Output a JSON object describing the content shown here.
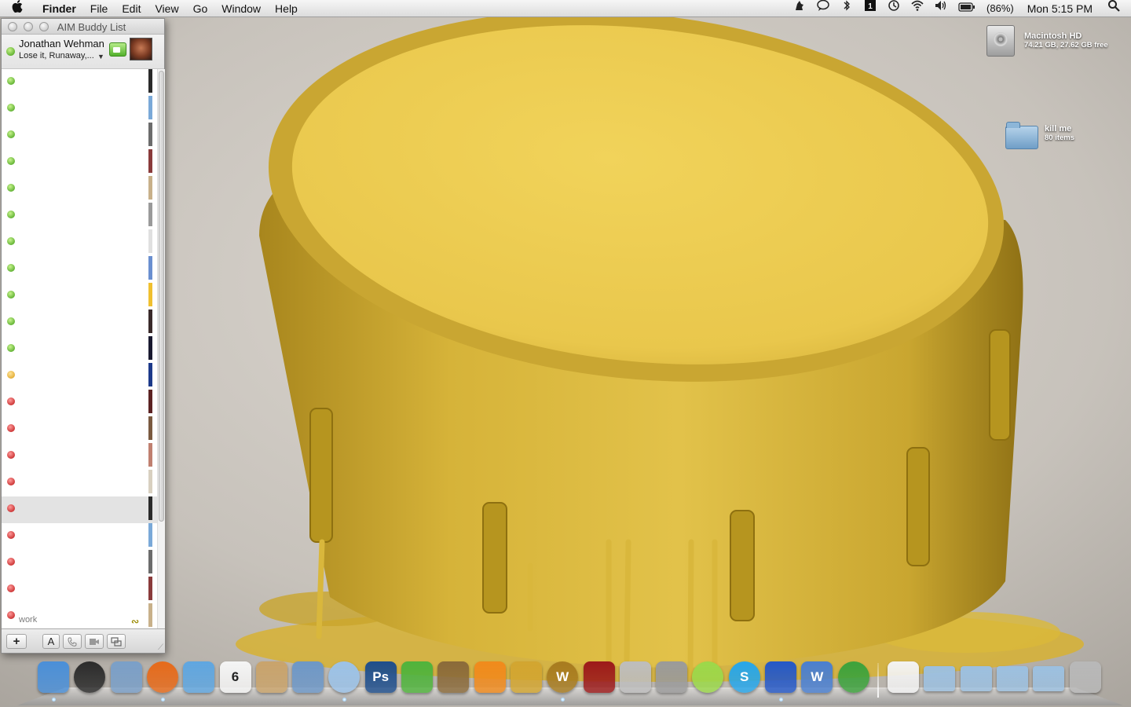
{
  "menubar": {
    "apple_icon": "apple-icon",
    "app_name": "Finder",
    "menus": [
      "File",
      "Edit",
      "View",
      "Go",
      "Window",
      "Help"
    ],
    "status_icons": [
      "growl-icon",
      "speech-bubble-icon",
      "bluetooth-icon",
      "spaces-icon",
      "time-machine-icon",
      "wifi-icon",
      "volume-icon",
      "battery-icon"
    ],
    "battery_text": "(86%)",
    "clock": "Mon 5:15 PM",
    "spotlight_icon": "spotlight-icon"
  },
  "aim": {
    "window_title": "AIM Buddy List",
    "user_name": "Jonathan Wehman",
    "status_message": "Lose it, Runaway,...",
    "buddies": [
      {
        "status": "available"
      },
      {
        "status": "available"
      },
      {
        "status": "available"
      },
      {
        "status": "available"
      },
      {
        "status": "available"
      },
      {
        "status": "available"
      },
      {
        "status": "available"
      },
      {
        "status": "available"
      },
      {
        "status": "available"
      },
      {
        "status": "available"
      },
      {
        "status": "available"
      },
      {
        "status": "away"
      },
      {
        "status": "offline"
      },
      {
        "status": "offline"
      },
      {
        "status": "offline"
      },
      {
        "status": "offline"
      },
      {
        "status": "offline"
      },
      {
        "status": "offline"
      },
      {
        "status": "offline"
      },
      {
        "status": "offline"
      },
      {
        "status": "offline"
      }
    ],
    "selected_buddy_index": 16,
    "group_label": "work",
    "toolbar": {
      "add_label": "+",
      "font_label": "A",
      "call_icon": "phone-icon",
      "video_icon": "video-icon",
      "share_icon": "share-screen-icon"
    }
  },
  "desktop": {
    "hd": {
      "name": "Macintosh HD",
      "info": "74.21 GB, 27.62 GB free"
    },
    "folder": {
      "name": "kill me",
      "info": "80 items"
    }
  },
  "dock": {
    "apps": [
      {
        "name": "Finder",
        "icon": "finder-icon",
        "color": "#4a8fd8",
        "running": true
      },
      {
        "name": "Dashboard",
        "icon": "dashboard-icon",
        "color": "#2b2b2b",
        "running": false
      },
      {
        "name": "Preview",
        "icon": "preview-icon",
        "color": "#7a9fc8",
        "running": false
      },
      {
        "name": "Firefox",
        "icon": "firefox-icon",
        "color": "#e66a1a",
        "running": true
      },
      {
        "name": "iChat",
        "icon": "ichat-icon",
        "color": "#5fa6e0",
        "running": false
      },
      {
        "name": "iCal",
        "icon": "ical-icon",
        "color": "#f4f4f4",
        "label": "6",
        "running": false
      },
      {
        "name": "Address Book",
        "icon": "address-book-icon",
        "color": "#c9a36b",
        "running": false
      },
      {
        "name": "iPhoto",
        "icon": "iphoto-icon",
        "color": "#6d97c7",
        "running": false
      },
      {
        "name": "iTunes",
        "icon": "itunes-icon",
        "color": "#9bc2e8",
        "running": true
      },
      {
        "name": "Photoshop",
        "icon": "photoshop-icon",
        "color": "#1e4e8c",
        "label": "Ps",
        "running": false
      },
      {
        "name": "Leaf",
        "icon": "leaf-icon",
        "color": "#4fb33c",
        "running": false
      },
      {
        "name": "Image Capture",
        "icon": "camera-icon",
        "color": "#8a6a3a",
        "running": false
      },
      {
        "name": "VLC",
        "icon": "vlc-icon",
        "color": "#f08a1c",
        "running": false
      },
      {
        "name": "Adium",
        "icon": "pineapple-icon",
        "color": "#d2a530",
        "running": false
      },
      {
        "name": "World of Warcraft",
        "icon": "wow-icon",
        "color": "#a77b1f",
        "label": "W",
        "running": true
      },
      {
        "name": "Front Row",
        "icon": "front-row-icon",
        "color": "#9c1a1a",
        "running": false
      },
      {
        "name": "Script Editor",
        "icon": "pen-icon",
        "color": "#bdbdbd",
        "running": false
      },
      {
        "name": "System Preferences",
        "icon": "gear-icon",
        "color": "#9a9a9a",
        "running": false
      },
      {
        "name": "LimeWire",
        "icon": "lime-icon",
        "color": "#9bd84a",
        "running": false
      },
      {
        "name": "Skype",
        "icon": "skype-icon",
        "color": "#26a6ea",
        "label": "S",
        "running": false
      },
      {
        "name": "Frog",
        "icon": "frog-icon",
        "color": "#2458c8",
        "running": true
      },
      {
        "name": "Word",
        "icon": "word-icon",
        "color": "#4a7fd0",
        "label": "W",
        "running": false
      },
      {
        "name": "Sync",
        "icon": "sync-icon",
        "color": "#3ca23c",
        "running": false
      }
    ],
    "stacks": [
      {
        "name": "Home",
        "icon": "home-icon",
        "color": "#f2f2f2"
      },
      {
        "name": "Documents",
        "icon": "documents-folder-icon",
        "color": "#9cc0e0"
      },
      {
        "name": "Applications",
        "icon": "applications-folder-icon",
        "color": "#9cc0e0"
      },
      {
        "name": "Downloads",
        "icon": "downloads-folder-icon",
        "color": "#9cc0e0"
      },
      {
        "name": "Folder",
        "icon": "folder-icon",
        "color": "#9cc0e0"
      },
      {
        "name": "Trash",
        "icon": "trash-icon",
        "color": "#b8b8b8"
      }
    ]
  }
}
